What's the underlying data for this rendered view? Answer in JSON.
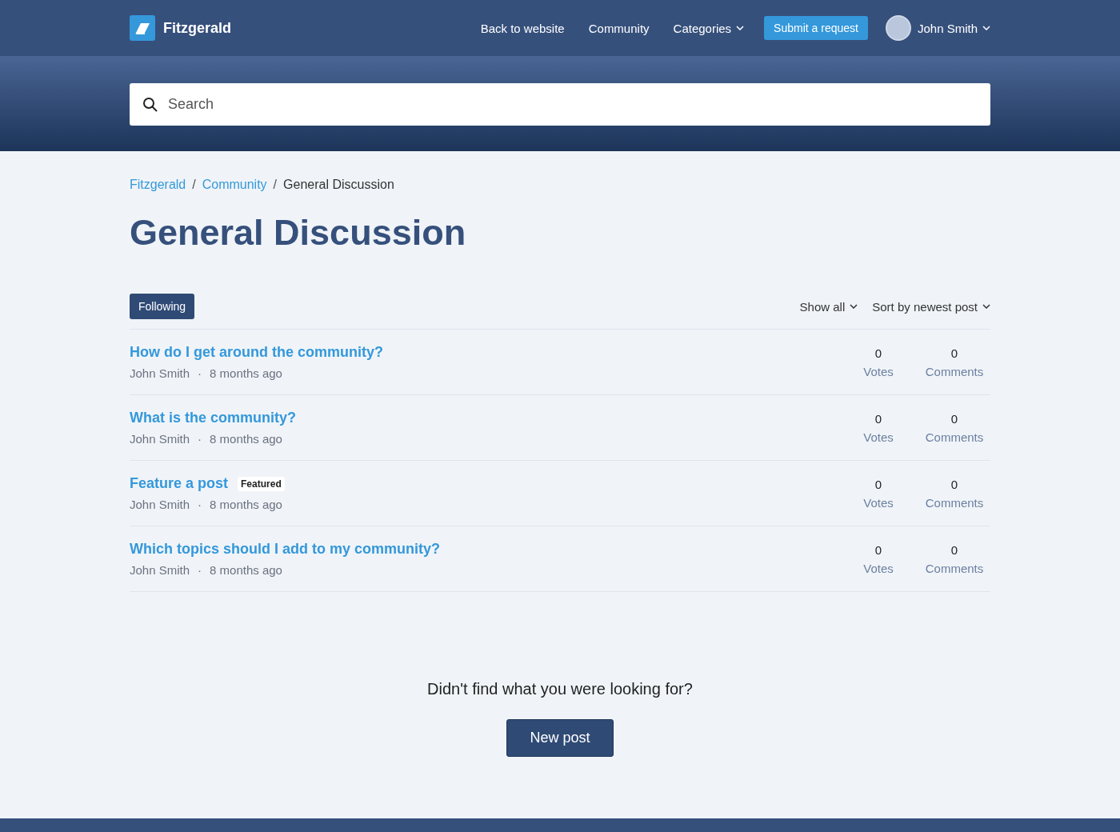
{
  "header": {
    "brand": "Fitzgerald",
    "nav": [
      {
        "label": "Back to website",
        "kind": "link"
      },
      {
        "label": "Community",
        "kind": "link"
      },
      {
        "label": "Categories",
        "kind": "dropdown"
      },
      {
        "label": "Submit a request",
        "kind": "button"
      }
    ],
    "user": {
      "name": "John Smith"
    }
  },
  "search": {
    "placeholder": "Search"
  },
  "breadcrumbs": [
    {
      "label": "Fitzgerald",
      "current": false
    },
    {
      "label": "Community",
      "current": false
    },
    {
      "label": "General Discussion",
      "current": true
    }
  ],
  "breadcrumb_separator": "/",
  "title": "General Discussion",
  "toolbar": {
    "follow_button": "Following",
    "filter": "Show all",
    "sort": "Sort by newest post"
  },
  "posts": [
    {
      "title": "How do I get around the community?",
      "author": "John Smith",
      "separator": "·",
      "time": "8 months ago",
      "votes": "0",
      "votes_label": "Votes",
      "comments": "0",
      "comments_label": "Comments"
    },
    {
      "title": "What is the community?",
      "author": "John Smith",
      "separator": "·",
      "time": "8 months ago",
      "votes": "0",
      "votes_label": "Votes",
      "comments": "0",
      "comments_label": "Comments"
    },
    {
      "title": "Feature a post",
      "badge": "Featured",
      "author": "John Smith",
      "separator": "·",
      "time": "8 months ago",
      "votes": "0",
      "votes_label": "Votes",
      "comments": "0",
      "comments_label": "Comments"
    },
    {
      "title": "Which topics should I add to my community?",
      "author": "John Smith",
      "separator": "·",
      "time": "8 months ago",
      "votes": "0",
      "votes_label": "Votes",
      "comments": "0",
      "comments_label": "Comments"
    }
  ],
  "footer_prompt": {
    "text": "Didn't find what you were looking for?",
    "button": "New post"
  }
}
